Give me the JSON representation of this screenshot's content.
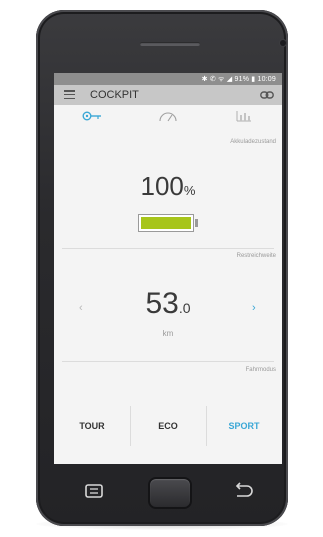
{
  "status_bar": {
    "text": "✱ ✆ ᯤ ◢ 91% ▮ 10:09"
  },
  "app_bar": {
    "title": "COCKPIT"
  },
  "tabs": [
    {
      "icon": "key-icon",
      "active": true
    },
    {
      "icon": "speedometer-icon",
      "active": false
    },
    {
      "icon": "chart-icon",
      "active": false
    }
  ],
  "battery_section": {
    "label": "Akkuladezustand",
    "value": "100",
    "unit": "%",
    "level": 1.0,
    "fill_color": "#a7c51a"
  },
  "range_section": {
    "label": "Restreichweite",
    "value": "53",
    "decimal": ".0",
    "unit": "km",
    "prev_arrow": "‹",
    "next_arrow": "›"
  },
  "mode_section": {
    "label": "Fahrmodus",
    "modes": [
      "TOUR",
      "ECO",
      "SPORT"
    ],
    "active": "SPORT"
  },
  "colors": {
    "accent": "#3aa7d6",
    "battery_green": "#a7c51a",
    "app_bar": "#c7c7c7",
    "status_bar": "#8e8e8e"
  }
}
